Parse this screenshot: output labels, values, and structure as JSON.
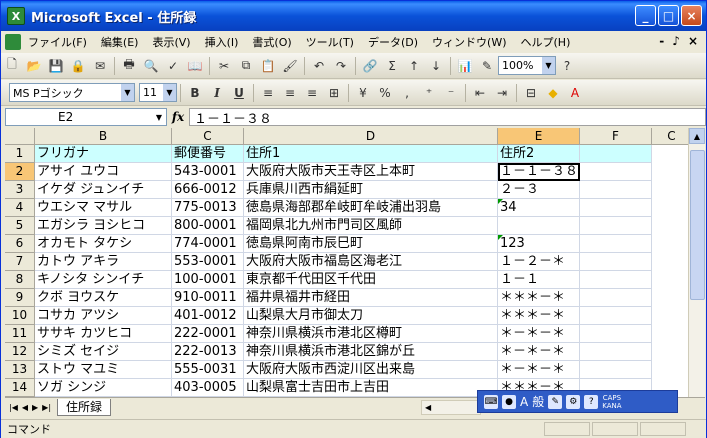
{
  "title": "Microsoft Excel - 住所録",
  "window_buttons": {
    "minimize": "_",
    "maximize": "□",
    "close": "×"
  },
  "menu": [
    "ファイル(F)",
    "編集(E)",
    "表示(V)",
    "挿入(I)",
    "書式(O)",
    "ツール(T)",
    "データ(D)",
    "ウィンドウ(W)",
    "ヘルプ(H)"
  ],
  "menu_right": {
    "minimize": "-",
    "restore": "♪",
    "close": "×"
  },
  "toolbar": {
    "zoom": "100%",
    "sigma": "Σ",
    "help": "?"
  },
  "format_toolbar": {
    "font": "MS Pゴシック",
    "size": "11",
    "bold": "B",
    "italic": "I",
    "underline": "U",
    "percent": "%",
    "comma": ","
  },
  "formula_bar": {
    "name_box": "E2",
    "fx": "fx",
    "content": "１－１－３８"
  },
  "columns": [
    {
      "label": "B",
      "active": false
    },
    {
      "label": "C",
      "active": false
    },
    {
      "label": "D",
      "active": false
    },
    {
      "label": "E",
      "active": true
    },
    {
      "label": "F",
      "active": false
    },
    {
      "label": "C",
      "active": false
    }
  ],
  "rows": [
    {
      "num": "1",
      "cells": [
        "フリガナ",
        "郵便番号",
        "住所1",
        "住所2",
        ""
      ]
    },
    {
      "num": "2",
      "cells": [
        "アサイ ユウコ",
        "543-0001",
        "大阪府大阪市天王寺区上本町",
        "１－１－３８",
        ""
      ]
    },
    {
      "num": "3",
      "cells": [
        "イケダ ジュンイチ",
        "666-0012",
        "兵庫県川西市絹延町",
        "２－３",
        ""
      ]
    },
    {
      "num": "4",
      "cells": [
        "ウエシマ マサル",
        "775-0013",
        "徳島県海部郡牟岐町牟岐浦出羽島",
        "34",
        ""
      ]
    },
    {
      "num": "5",
      "cells": [
        "エガシラ ヨシヒコ",
        "800-0001",
        "福岡県北九州市門司区風師",
        "",
        ""
      ]
    },
    {
      "num": "6",
      "cells": [
        "オカモト タケシ",
        "774-0001",
        "徳島県阿南市辰巳町",
        "123",
        ""
      ]
    },
    {
      "num": "7",
      "cells": [
        "カトウ アキラ",
        "553-0001",
        "大阪府大阪市福島区海老江",
        "１－２－＊",
        ""
      ]
    },
    {
      "num": "8",
      "cells": [
        "キノシタ シンイチ",
        "100-0001",
        "東京都千代田区千代田",
        "１－１",
        ""
      ]
    },
    {
      "num": "9",
      "cells": [
        "クボ ヨウスケ",
        "910-0011",
        "福井県福井市経田",
        "＊＊＊－＊",
        ""
      ]
    },
    {
      "num": "10",
      "cells": [
        "コサカ アツシ",
        "401-0012",
        "山梨県大月市御太刀",
        "＊＊＊－＊",
        ""
      ]
    },
    {
      "num": "11",
      "cells": [
        "ササキ カツヒコ",
        "222-0001",
        "神奈川県横浜市港北区樽町",
        "＊－＊－＊",
        ""
      ]
    },
    {
      "num": "12",
      "cells": [
        "シミズ セイジ",
        "222-0013",
        "神奈川県横浜市港北区錦が丘",
        "＊－＊－＊",
        ""
      ]
    },
    {
      "num": "13",
      "cells": [
        "ストウ マユミ",
        "555-0031",
        "大阪府大阪市西淀川区出来島",
        "＊－＊－＊",
        ""
      ]
    },
    {
      "num": "14",
      "cells": [
        "ソガ シンジ",
        "403-0005",
        "山梨県富士吉田市上吉田",
        "＊＊＊－＊",
        ""
      ]
    }
  ],
  "sheet_tab": "住所録",
  "status": "コマンド",
  "langbar": {
    "mode": "A",
    "dict": "般",
    "caps": "CAPS",
    "kana": "KANA"
  }
}
